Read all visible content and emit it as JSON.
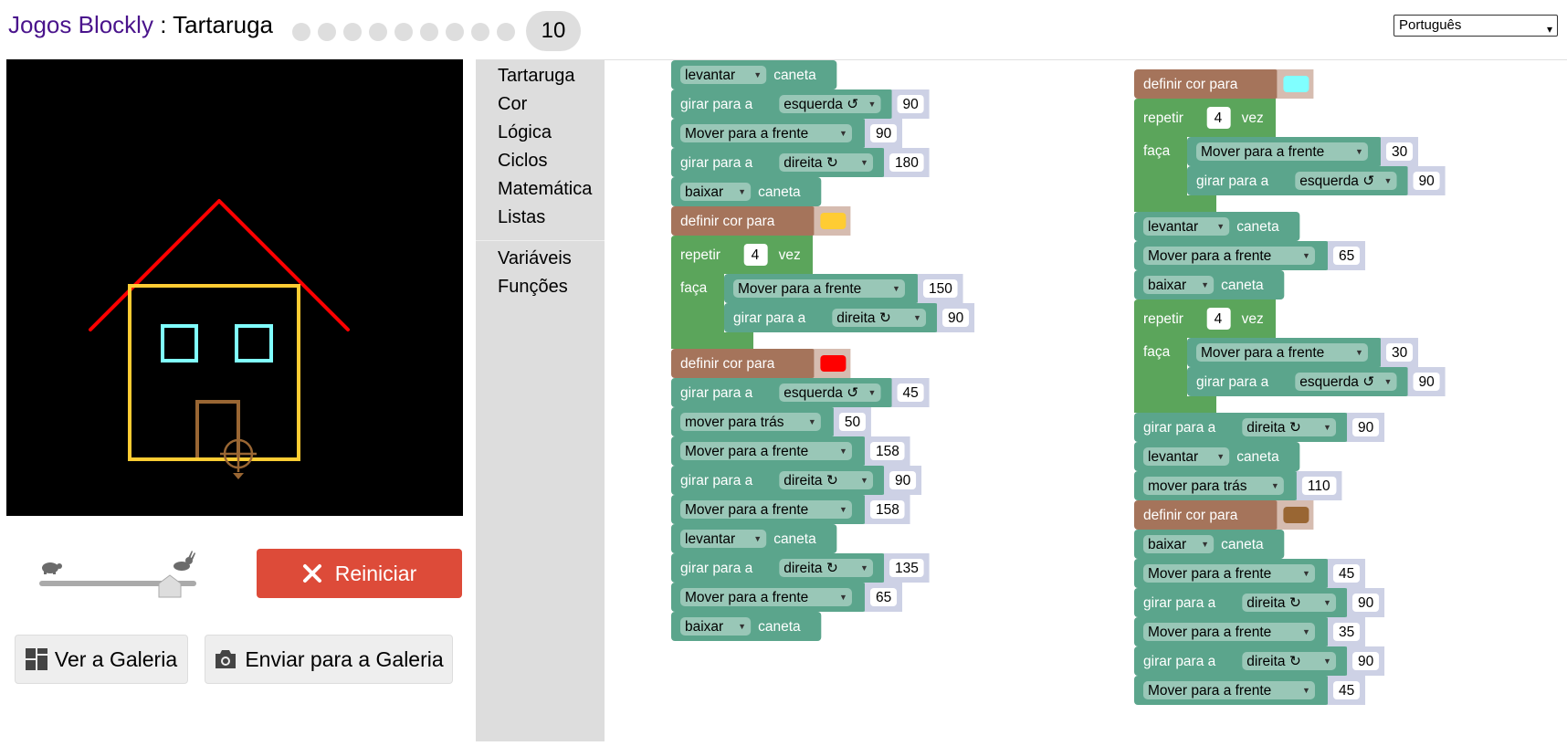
{
  "header": {
    "app_link": "Jogos Blockly",
    "separator": " : ",
    "game_name": "Tartaruga",
    "current_level": "10",
    "language": "Português"
  },
  "canvas": {
    "colors": {
      "roof": "#ff0000",
      "walls": "#ffcc33",
      "windows": "#80ffff",
      "door": "#996633",
      "turtle": "#996633"
    }
  },
  "controls": {
    "speed_level": 0.83,
    "reset_label": "Reiniciar",
    "gallery_label": "Ver a Galeria",
    "submit_label": "Enviar para a Galeria"
  },
  "toolbox": {
    "categories": [
      "Tartaruga",
      "Cor",
      "Lógica",
      "Ciclos",
      "Matemática",
      "Listas"
    ],
    "categories2": [
      "Variáveis",
      "Funções"
    ]
  },
  "colors": {
    "turtle_block": "#5ba58c",
    "loop_block": "#5ba55b",
    "colour_block": "#a5745b",
    "value_bg": "#cdd1e5",
    "reset": "#dd4b39"
  },
  "stacks": [
    [
      {
        "t": "pen",
        "v": "levantar"
      },
      {
        "t": "turn",
        "v": "esquerda ↺",
        "n": "90"
      },
      {
        "t": "move",
        "v": "Mover para a frente",
        "n": "90"
      },
      {
        "t": "turn",
        "v": "direita ↻",
        "n": "180"
      },
      {
        "t": "pen",
        "v": "baixar"
      },
      {
        "t": "colour",
        "c": "#ffcc33"
      },
      {
        "t": "repeat",
        "n": "4",
        "body": [
          {
            "t": "move",
            "v": "Mover para a frente",
            "n": "150"
          },
          {
            "t": "turn",
            "v": "direita ↻",
            "n": "90"
          }
        ]
      },
      {
        "t": "colour",
        "c": "#ff0000"
      },
      {
        "t": "turn",
        "v": "esquerda ↺",
        "n": "45"
      },
      {
        "t": "move",
        "v": "mover para trás",
        "n": "50"
      },
      {
        "t": "move",
        "v": "Mover para a frente",
        "n": "158"
      },
      {
        "t": "turn",
        "v": "direita ↻",
        "n": "90"
      },
      {
        "t": "move",
        "v": "Mover para a frente",
        "n": "158"
      },
      {
        "t": "pen",
        "v": "levantar"
      },
      {
        "t": "turn",
        "v": "direita ↻",
        "n": "135"
      },
      {
        "t": "move",
        "v": "Mover para a frente",
        "n": "65"
      },
      {
        "t": "pen",
        "v": "baixar"
      }
    ],
    [
      {
        "t": "colour",
        "c": "#80ffff"
      },
      {
        "t": "repeat",
        "n": "4",
        "body": [
          {
            "t": "move",
            "v": "Mover para a frente",
            "n": "30"
          },
          {
            "t": "turn",
            "v": "esquerda ↺",
            "n": "90"
          }
        ]
      },
      {
        "t": "pen",
        "v": "levantar"
      },
      {
        "t": "move",
        "v": "Mover para a frente",
        "n": "65"
      },
      {
        "t": "pen",
        "v": "baixar"
      },
      {
        "t": "repeat",
        "n": "4",
        "body": [
          {
            "t": "move",
            "v": "Mover para a frente",
            "n": "30"
          },
          {
            "t": "turn",
            "v": "esquerda ↺",
            "n": "90"
          }
        ]
      },
      {
        "t": "turn",
        "v": "direita ↻",
        "n": "90"
      },
      {
        "t": "pen",
        "v": "levantar"
      },
      {
        "t": "move",
        "v": "mover para trás",
        "n": "110"
      },
      {
        "t": "colour",
        "c": "#996633"
      },
      {
        "t": "pen",
        "v": "baixar"
      },
      {
        "t": "move",
        "v": "Mover para a frente",
        "n": "45"
      },
      {
        "t": "turn",
        "v": "direita ↻",
        "n": "90"
      },
      {
        "t": "move",
        "v": "Mover para a frente",
        "n": "35"
      },
      {
        "t": "turn",
        "v": "direita ↻",
        "n": "90"
      },
      {
        "t": "move",
        "v": "Mover para a frente",
        "n": "45"
      }
    ]
  ],
  "labels": {
    "turn_prefix": "girar para a",
    "pen_suffix": "caneta",
    "colour_label": "definir cor para",
    "repeat_prefix": "repetir",
    "repeat_suffix": "vez",
    "do_label": "faça"
  }
}
